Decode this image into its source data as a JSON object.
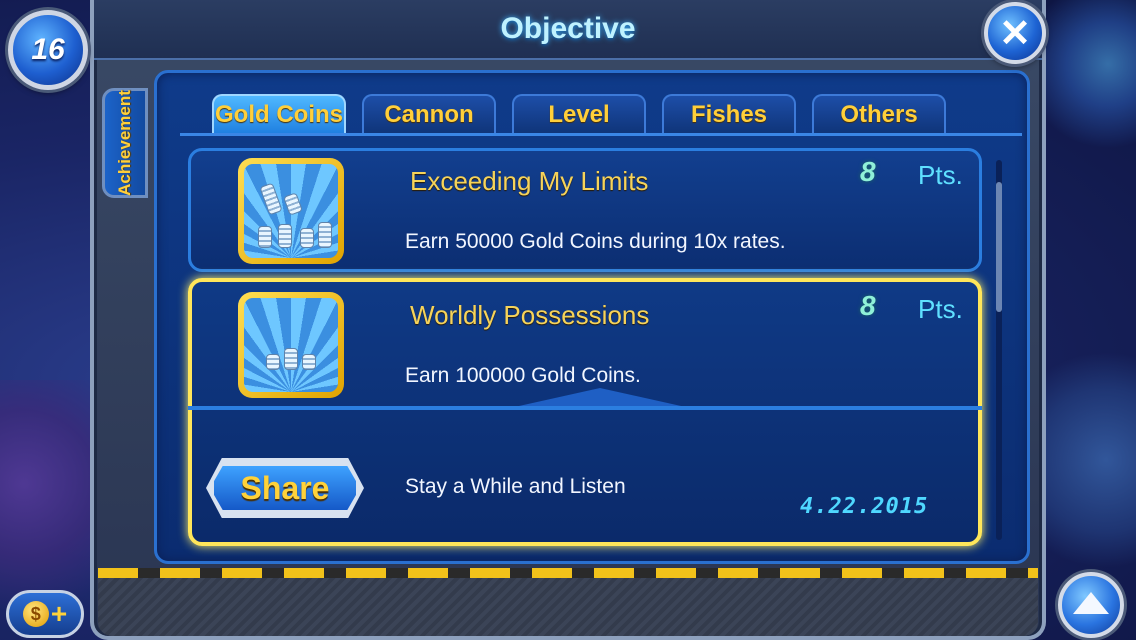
{
  "player": {
    "level": "16"
  },
  "header": {
    "title": "Objective"
  },
  "side_tab": {
    "label": "Achievement"
  },
  "tabs": [
    {
      "label": "Gold Coins",
      "active": true
    },
    {
      "label": "Cannon",
      "active": false
    },
    {
      "label": "Level",
      "active": false
    },
    {
      "label": "Fishes",
      "active": false
    },
    {
      "label": "Others",
      "active": false
    }
  ],
  "achievements": [
    {
      "title": "Exceeding My Limits",
      "description": "Earn 50000 Gold Coins during 10x rates.",
      "points": "8",
      "points_label": "Pts.",
      "icon": "coin-stacks-icon"
    },
    {
      "title": "Worldly Possessions",
      "description": "Earn 100000 Gold Coins.",
      "points": "8",
      "points_label": "Pts.",
      "icon": "coin-pile-icon"
    }
  ],
  "share": {
    "button_label": "Share",
    "caption": "Stay a While and Listen",
    "date": "4.22.2015"
  },
  "icons": {
    "close": "close-icon",
    "up": "arrow-up-icon",
    "coin": "coin-icon",
    "plus": "plus-icon"
  },
  "colors": {
    "accent_gold": "#ffcf3a",
    "highlight_border": "#ffe65a",
    "points_teal": "#8ff0d8",
    "date_cyan": "#4fd8ff"
  }
}
